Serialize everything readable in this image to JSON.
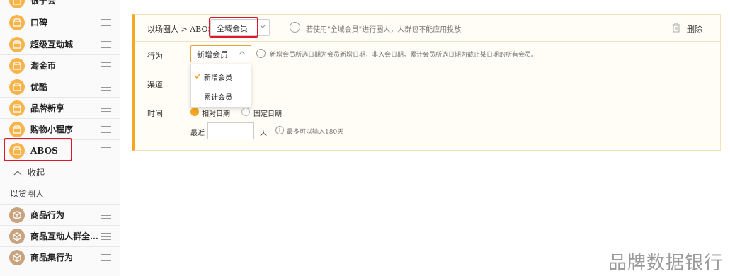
{
  "sidebar": {
    "items": [
      {
        "label": "银子会"
      },
      {
        "label": "口碑"
      },
      {
        "label": "超级互动城"
      },
      {
        "label": "淘金币"
      },
      {
        "label": "优酷"
      },
      {
        "label": "品牌新享"
      },
      {
        "label": "购物小程序"
      },
      {
        "label": "ABOS"
      }
    ],
    "collapse_label": "收起",
    "section_title": "以货圈人",
    "goods_items": [
      {
        "label": "商品行为"
      },
      {
        "label": "商品互动人群全…"
      },
      {
        "label": "商品集行为"
      }
    ]
  },
  "panel": {
    "breadcrumb": "以场圈人 > ABOS",
    "scope_select": "全域会员",
    "scope_hint": "若使用\"全域会员\"进行圈人，人群包不能应用投放",
    "delete_label": "删除",
    "behavior_label": "行为",
    "behavior_select": "新增会员",
    "behavior_hint": "新增会员所选日期为会员新增日期，非入会日期。累计会员所选日期为截止某日期的所有会员。",
    "channel_label": "渠道",
    "time_label": "时间",
    "radio_relative": "相对日期",
    "radio_fixed": "固定日期",
    "recent_label": "最近",
    "recent_value": "",
    "day_unit": "天",
    "max_hint": "最多可以输入180天",
    "dropdown_options": [
      "新增会员",
      "累计会员"
    ]
  },
  "watermark": "品牌数据银行",
  "colors": {
    "accent": "#f5a623",
    "highlight": "#e0182b"
  }
}
